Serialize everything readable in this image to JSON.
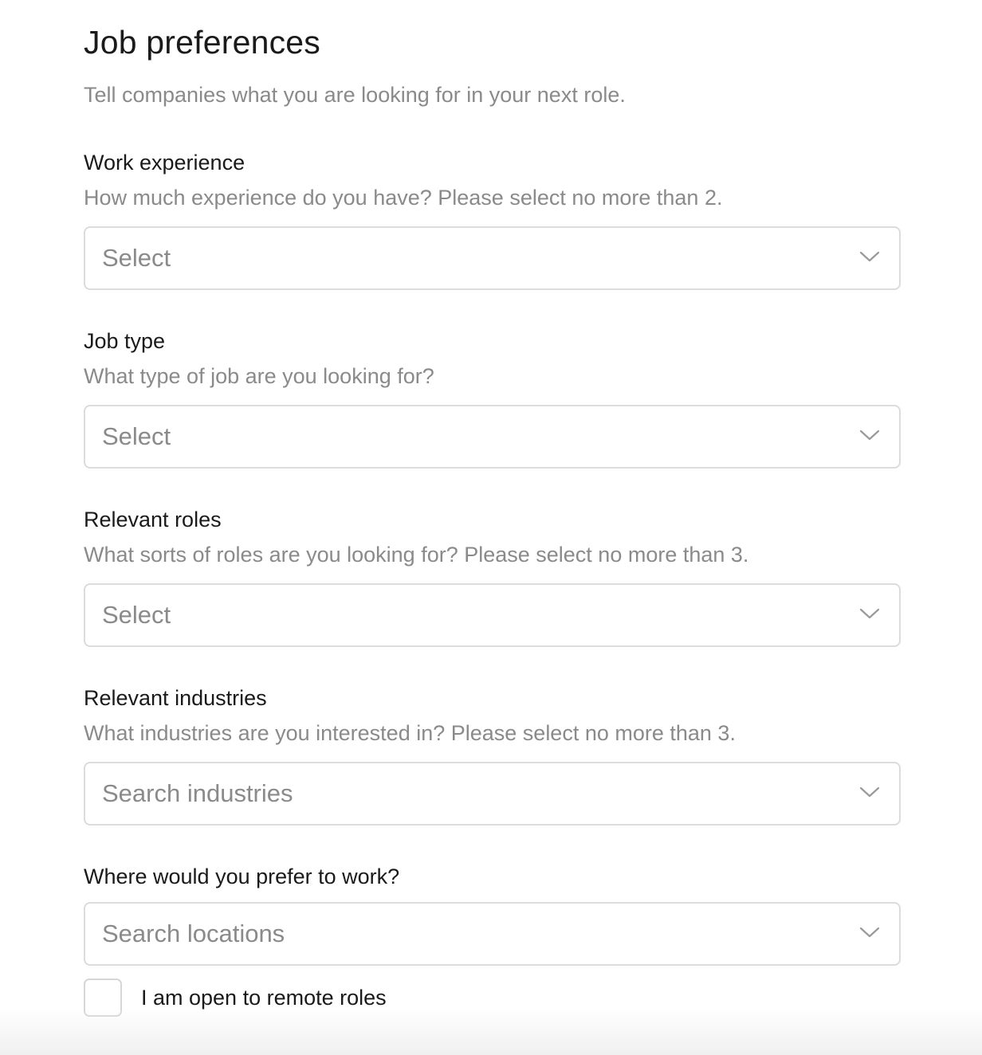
{
  "header": {
    "title": "Job preferences",
    "subtitle": "Tell companies what you are looking for in your next role."
  },
  "fields": [
    {
      "label": "Work experience",
      "help": "How much experience do you have? Please select no more than 2.",
      "placeholder": "Select"
    },
    {
      "label": "Job type",
      "help": "What type of job are you looking for?",
      "placeholder": "Select"
    },
    {
      "label": "Relevant roles",
      "help": "What sorts of roles are you looking for? Please select no more than 3.",
      "placeholder": "Select"
    },
    {
      "label": "Relevant industries",
      "help": "What industries are you interested in? Please select no more than 3.",
      "placeholder": "Search industries"
    },
    {
      "label": "Where would you prefer to work?",
      "placeholder": "Search locations"
    }
  ],
  "remote_checkbox": {
    "label": "I am open to remote roles",
    "checked": false
  },
  "icons": {
    "dropdown": "chevron-down-icon"
  },
  "colors": {
    "text_primary": "#1a1a1a",
    "text_secondary": "#8a8a8a",
    "border": "#dcdcdc",
    "background": "#ffffff"
  }
}
